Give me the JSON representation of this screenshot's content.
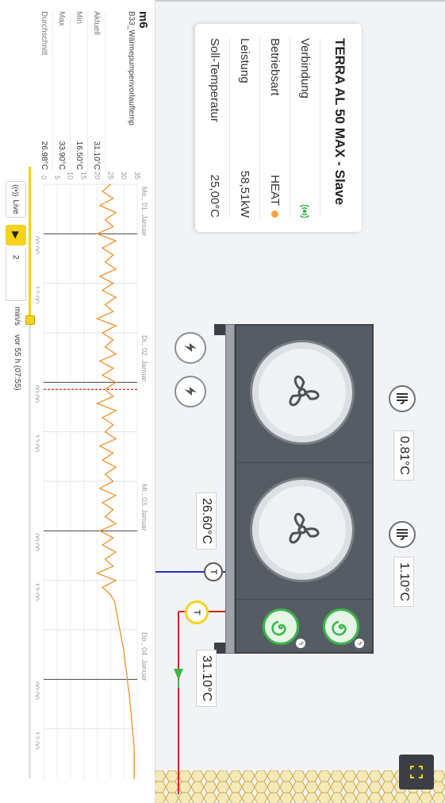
{
  "device": {
    "title": "TERRA AL 50 MAX - Slave",
    "rows": [
      {
        "label": "Verbindung",
        "value": ""
      },
      {
        "label": "Betriebsart",
        "value": "HEAT"
      },
      {
        "label": "Leistung",
        "value": "58,51kW"
      },
      {
        "label": "Soll-Temperatur",
        "value": "25,00°C"
      }
    ]
  },
  "schematic": {
    "temps": {
      "air_left": "0.81°C",
      "air_right": "1.10°C",
      "return_temp": "26.60°C",
      "flow_temp": "31.10°C"
    },
    "sensor_symbol": "T",
    "pipe_colors": {
      "flow": "#e02020",
      "return": "#2030c0",
      "accent": "#3cb54a"
    }
  },
  "stats": {
    "name": "m6",
    "subtitle": "B33_Wärmepumpenvorlauftemp",
    "rows": [
      {
        "label": "Aktuell",
        "value": "31.10°C"
      },
      {
        "label": "Min",
        "value": "16.50°C"
      },
      {
        "label": "Max",
        "value": "33.90°C"
      },
      {
        "label": "Durchschnitt",
        "value": "26.98°C"
      }
    ]
  },
  "chart_data": {
    "type": "line",
    "title": "",
    "xlabel": "",
    "ylabel": "",
    "ylim": [
      0,
      35
    ],
    "y_ticks": [
      0,
      5,
      10,
      15,
      20,
      25,
      30,
      35
    ],
    "x_ticks": [
      "Mo., 01. Januar",
      "00:00",
      "12:00",
      "Di., 02. Januar",
      "00:00",
      "12:00",
      "Mi., 03. Januar",
      "00:00",
      "12:00",
      "Do., 04. Januar",
      "00:00",
      "12:00"
    ],
    "x_hours_range": [
      0,
      84
    ],
    "marker_hour": 29,
    "series": [
      {
        "color": "#f0922b",
        "x": [
          0,
          1,
          2,
          3,
          4,
          5,
          6,
          7,
          8,
          9,
          10,
          11,
          12,
          13,
          14,
          15,
          16,
          17,
          18,
          19,
          20,
          21,
          22,
          23,
          24,
          25,
          26,
          27,
          28,
          29,
          30,
          31,
          32,
          33,
          34,
          35,
          36,
          37,
          38,
          39,
          40,
          41,
          42,
          43,
          44,
          45,
          46,
          47,
          48,
          49,
          50,
          51,
          52,
          53,
          54,
          55,
          56,
          57,
          58,
          59,
          60,
          61,
          62,
          63,
          64,
          65,
          66,
          67,
          68,
          69,
          70,
          71,
          72,
          73,
          74,
          75,
          76,
          77,
          78,
          79,
          80,
          81,
          82,
          83,
          84
        ],
        "values": [
          25,
          22,
          26,
          21,
          27,
          23,
          26,
          20,
          27,
          22,
          26,
          23,
          27,
          21,
          26,
          22,
          27,
          23,
          26,
          20,
          27,
          22,
          26,
          23,
          27,
          21,
          26,
          22,
          27,
          23,
          26,
          20,
          27,
          22,
          26,
          23,
          27,
          21,
          26,
          22,
          27,
          23,
          26,
          21,
          27,
          22,
          26,
          23,
          27,
          21,
          26,
          22,
          27,
          23,
          26,
          20,
          27,
          22,
          25,
          26.5,
          27,
          27.5,
          28,
          28.5,
          29,
          29.5,
          30,
          30.3,
          30.6,
          31,
          31.3,
          31.6,
          32,
          32.2,
          32.5,
          32.8,
          33,
          33.2,
          33.5,
          33.7,
          33.9,
          33.9,
          33.9,
          33.9,
          33.9
        ]
      }
    ]
  },
  "controls": {
    "live_label": "Live",
    "speed_value": "2",
    "speed_unit": "min/s",
    "time_offset": "vor 55 h (07:55)",
    "slider_fraction": 0.25
  },
  "icons": {
    "expand": "expand-icon",
    "fan": "fan-icon",
    "air_sensor": "air-sensor-icon",
    "bolt": "lightning-icon",
    "wifi": "connection-signal-icon",
    "close": "close-icon"
  },
  "close_label": "×"
}
